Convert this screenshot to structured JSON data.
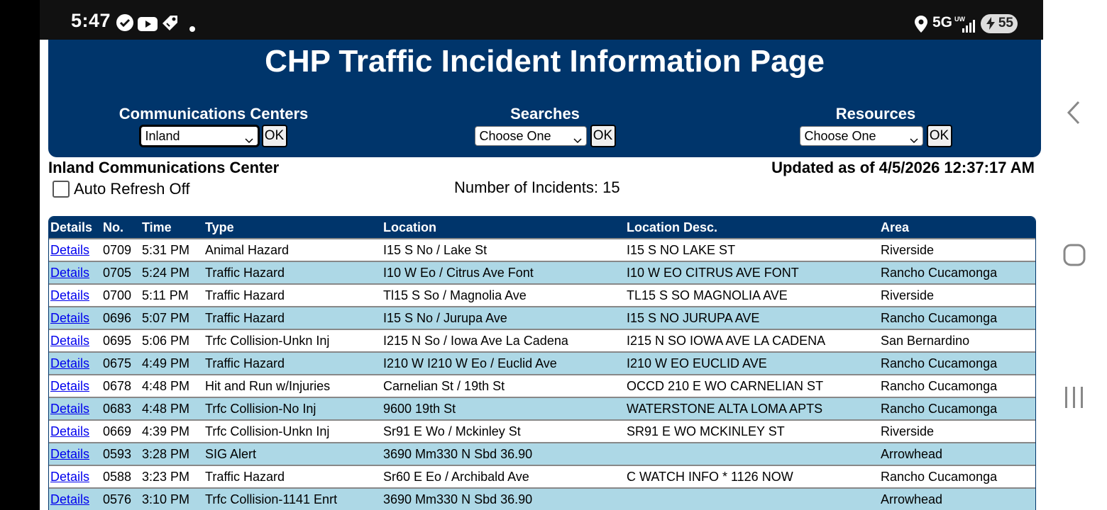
{
  "status_bar": {
    "time": "5:47",
    "network": "5G",
    "network_sub": "UW",
    "battery": "55",
    "icons": [
      "check-badge-icon",
      "youtube-icon",
      "tag-icon",
      "dot-icon",
      "location-icon",
      "signal-icon",
      "battery-icon"
    ]
  },
  "header": {
    "title": "CHP Traffic Incident Information Page",
    "comm_centers": {
      "label": "Communications Centers",
      "selected": "Inland",
      "ok": "OK"
    },
    "searches": {
      "label": "Searches",
      "selected": "Choose One",
      "ok": "OK"
    },
    "resources": {
      "label": "Resources",
      "selected": "Choose One",
      "ok": "OK"
    }
  },
  "info": {
    "center_name": "Inland Communications Center",
    "updated": "Updated as of 4/5/2026 12:37:17 AM",
    "auto_refresh": "Auto Refresh Off",
    "incidents_count": "Number of Incidents: 15"
  },
  "table": {
    "columns": [
      "Details",
      "No.",
      "Time",
      "Type",
      "Location",
      "Location Desc.",
      "Area"
    ],
    "rows": [
      {
        "details": "Details",
        "no": "0709",
        "time": "5:31 PM",
        "type": "Animal Hazard",
        "location": "I15 S No / Lake St",
        "desc": "I15 S NO LAKE ST",
        "area": "Riverside"
      },
      {
        "details": "Details",
        "no": "0705",
        "time": "5:24 PM",
        "type": "Traffic Hazard",
        "location": "I10 W Eo / Citrus Ave Font",
        "desc": "I10 W EO CITRUS AVE FONT",
        "area": "Rancho Cucamonga"
      },
      {
        "details": "Details",
        "no": "0700",
        "time": "5:11 PM",
        "type": "Traffic Hazard",
        "location": "Tl15 S So / Magnolia Ave",
        "desc": "TL15 S SO MAGNOLIA AVE",
        "area": "Riverside"
      },
      {
        "details": "Details",
        "no": "0696",
        "time": "5:07 PM",
        "type": "Traffic Hazard",
        "location": "I15 S No / Jurupa Ave",
        "desc": "I15 S NO JURUPA AVE",
        "area": "Rancho Cucamonga"
      },
      {
        "details": "Details",
        "no": "0695",
        "time": "5:06 PM",
        "type": "Trfc Collision-Unkn Inj",
        "location": "I215 N So / Iowa Ave La Cadena",
        "desc": "I215 N SO IOWA AVE LA CADENA",
        "area": "San Bernardino"
      },
      {
        "details": "Details",
        "no": "0675",
        "time": "4:49 PM",
        "type": "Traffic Hazard",
        "location": "I210 W I210 W Eo / Euclid Ave",
        "desc": "I210 W EO EUCLID AVE",
        "area": "Rancho Cucamonga"
      },
      {
        "details": "Details",
        "no": "0678",
        "time": "4:48 PM",
        "type": "Hit and Run w/Injuries",
        "location": "Carnelian St / 19th St",
        "desc": "OCCD 210 E WO CARNELIAN ST",
        "area": "Rancho Cucamonga"
      },
      {
        "details": "Details",
        "no": "0683",
        "time": "4:48 PM",
        "type": "Trfc Collision-No Inj",
        "location": "9600 19th St",
        "desc": "WATERSTONE ALTA LOMA APTS",
        "area": "Rancho Cucamonga"
      },
      {
        "details": "Details",
        "no": "0669",
        "time": "4:39 PM",
        "type": "Trfc Collision-Unkn Inj",
        "location": "Sr91 E Wo / Mckinley St",
        "desc": "SR91 E WO MCKINLEY ST",
        "area": "Riverside"
      },
      {
        "details": "Details",
        "no": "0593",
        "time": "3:28 PM",
        "type": "SIG Alert",
        "location": "3690 Mm330 N Sbd 36.90",
        "desc": "",
        "area": "Arrowhead"
      },
      {
        "details": "Details",
        "no": "0588",
        "time": "3:23 PM",
        "type": "Traffic Hazard",
        "location": "Sr60 E Eo / Archibald Ave",
        "desc": "C WATCH INFO * 1126 NOW",
        "area": "Rancho Cucamonga"
      },
      {
        "details": "Details",
        "no": "0576",
        "time": "3:10 PM",
        "type": "Trfc Collision-1141 Enrt",
        "location": "3690 Mm330 N Sbd 36.90",
        "desc": "",
        "area": "Arrowhead"
      },
      {
        "details": "",
        "no": "",
        "time": "",
        "type": "",
        "location": "",
        "desc": "",
        "area": ""
      }
    ]
  },
  "nav": {
    "icons": [
      "back-icon",
      "home-icon",
      "recents-icon"
    ]
  }
}
